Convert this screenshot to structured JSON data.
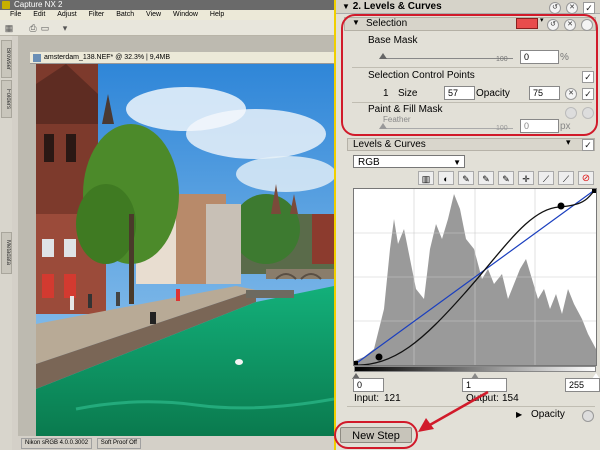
{
  "app": {
    "title": "Capture NX 2",
    "menu": [
      "File",
      "Edit",
      "Adjust",
      "Filter",
      "Batch",
      "View",
      "Window",
      "Help"
    ],
    "side_tabs": [
      "Browser",
      "Folders",
      "Metadata"
    ]
  },
  "document": {
    "title": "amsterdam_138.NEF* @ 32.3% | 9,4MB",
    "status": [
      "Nikon sRGB 4.0.0.3002",
      "Soft Proof Off"
    ]
  },
  "panel": {
    "title": "2. Levels & Curves",
    "selection": {
      "label": "Selection",
      "base_mask_label": "Base Mask",
      "base_mask_value": "0",
      "base_mask_unit": "%",
      "base_mask_slider_max": "100",
      "control_points_label": "Selection Control Points",
      "point_index": "1",
      "size_label": "Size",
      "size_value": "57",
      "opacity_label": "Opacity",
      "opacity_value": "75",
      "paint_fill_label": "Paint & Fill Mask",
      "feather_label": "Feather",
      "feather_value": "0",
      "feather_unit": "px",
      "feather_slider_max": "100",
      "color_swatch": "#e84c4c"
    },
    "levels": {
      "label": "Levels & Curves",
      "channel": "RGB",
      "black_point": "0",
      "gamma": "1",
      "white_point": "255",
      "input_label": "Input:",
      "input_value": "121",
      "output_label": "Output:",
      "output_value": "154",
      "opacity_label": "Opacity"
    },
    "new_step_label": "New Step"
  }
}
